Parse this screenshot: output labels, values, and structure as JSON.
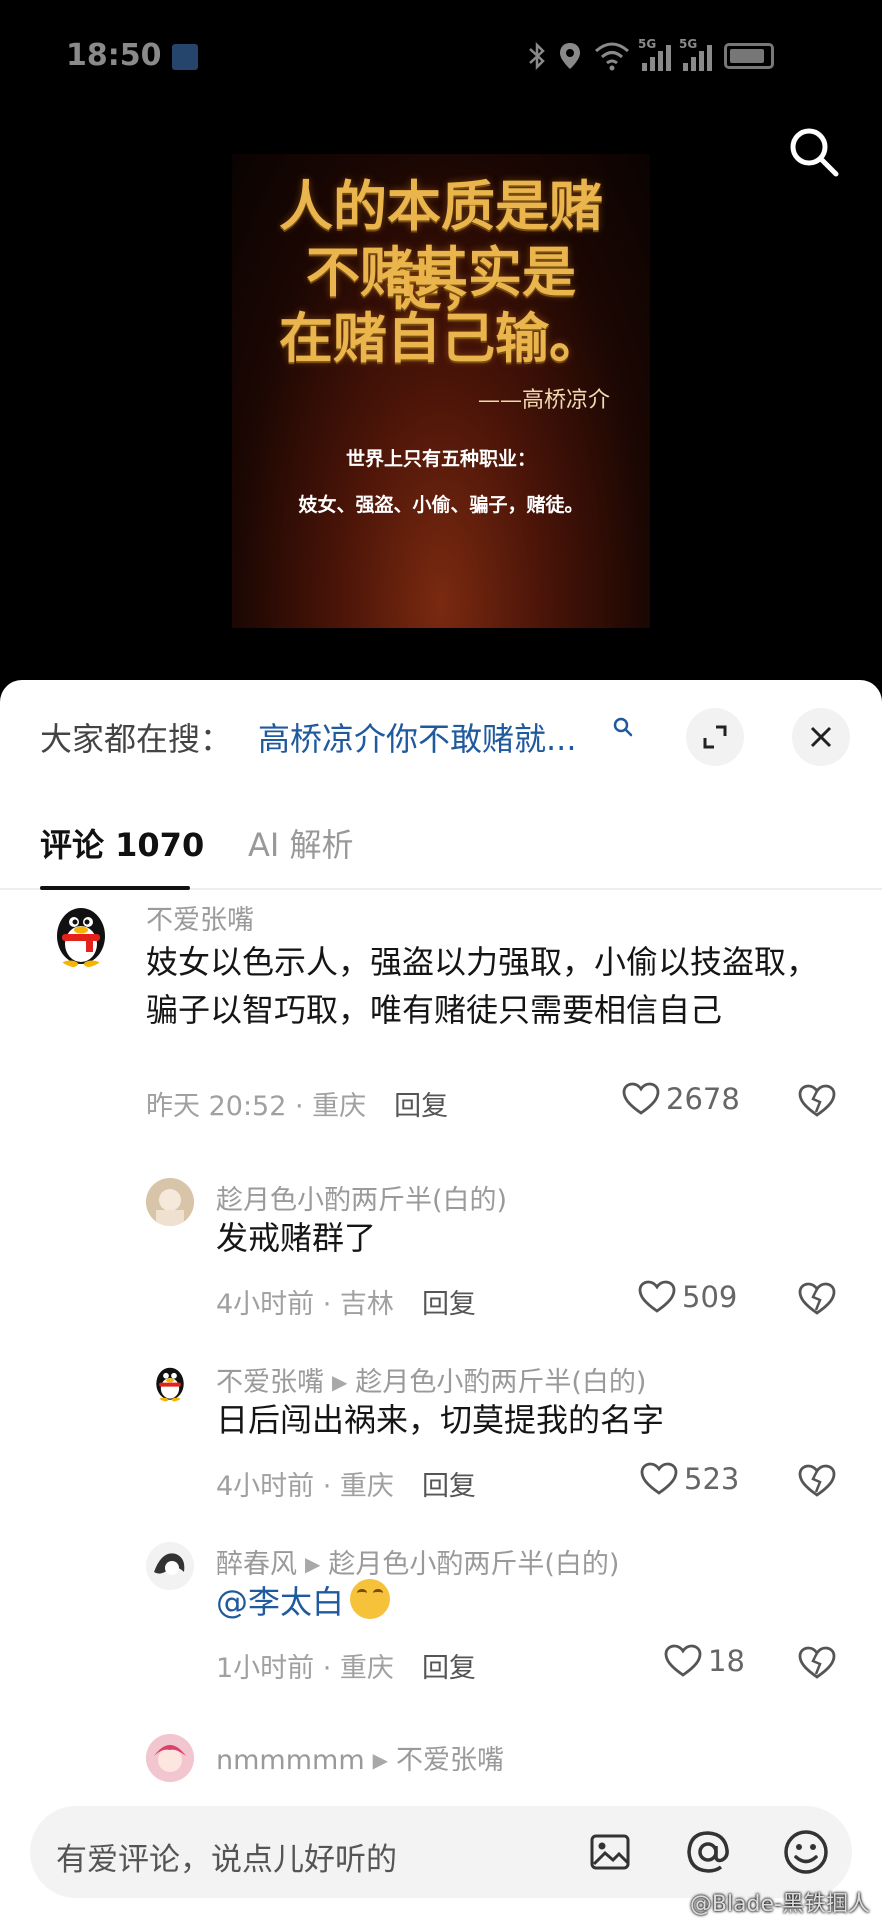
{
  "status_bar": {
    "time": "18:50",
    "network_5g_a": "5G",
    "network_5g_b": "5G"
  },
  "poster": {
    "line1": "人的本质是赌徒，",
    "line2": "不赌其实是",
    "line3": "在赌自己输。",
    "author": "——高桥凉介",
    "sub1": "世界上只有五种职业：",
    "sub2": "妓女、强盗、小偷、骗子，赌徒。"
  },
  "search_bar": {
    "prefix": "大家都在搜：",
    "query": "高桥凉介你不敢赌就..."
  },
  "tabs": {
    "comments": "评论 1070",
    "ai": "AI 解析"
  },
  "comments": [
    {
      "user": "不爱张嘴",
      "text": "妓女以色示人，强盗以力强取，小偷以技盗取，骗子以智巧取，唯有赌徒只需要相信自己",
      "meta": "昨天 20:52 · 重庆",
      "reply": "回复",
      "likes": "2678"
    },
    {
      "user": "趁月色小酌两斤半(白的)",
      "text": "发戒赌群了",
      "meta": "4小时前 · 吉林",
      "reply": "回复",
      "likes": "509"
    },
    {
      "user": "不爱张嘴",
      "reply_to": "趁月色小酌两斤半(白的)",
      "text": "日后闯出祸来，切莫提我的名字",
      "meta": "4小时前 · 重庆",
      "reply": "回复",
      "likes": "523"
    },
    {
      "user": "醉春风",
      "reply_to": "趁月色小酌两斤半(白的)",
      "text": "@李太白",
      "meta": "1小时前 · 重庆",
      "reply": "回复",
      "likes": "18"
    },
    {
      "user": "nmmmmm",
      "reply_to": "不爱张嘴"
    }
  ],
  "input": {
    "placeholder": "有爱评论，说点儿好听的"
  },
  "watermark": "@Blade-黑铁掴人",
  "colors": {
    "link": "#1f5a9e",
    "poster_gold": "#e9b54c"
  }
}
